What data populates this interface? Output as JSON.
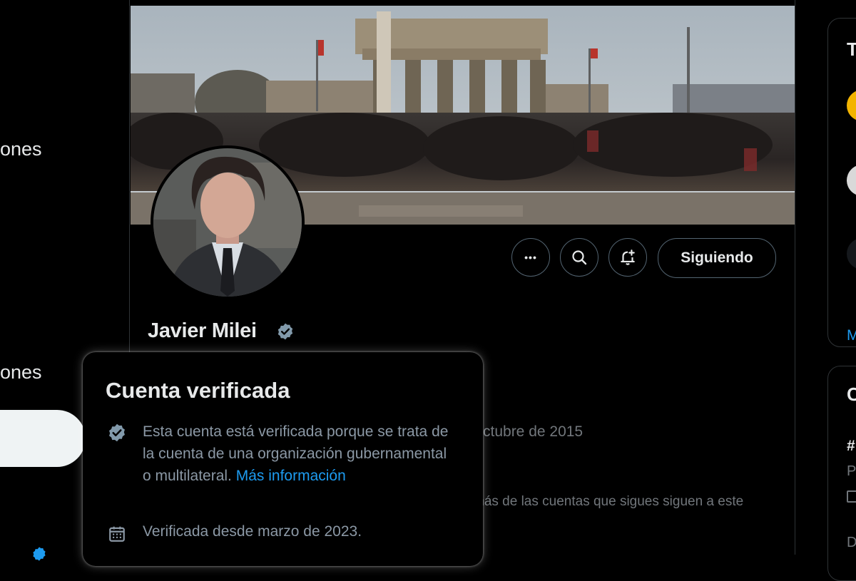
{
  "nav": {
    "item_a_partial": "ones",
    "item_b_partial": "ones"
  },
  "profile": {
    "name": "Javier Milei",
    "follow_label": "Siguiendo",
    "joined_partial": "ctubre de 2015",
    "followers_note_partial": "más de las cuentas que sigues siguen a este",
    "more_icon_glyph": "•••"
  },
  "verified_tooltip": {
    "title": "Cuenta verificada",
    "description": "Esta cuenta está verificada porque se trata de la cuenta de una organización gubernamental o multilateral.",
    "link_text": "Más información",
    "verified_since": "Verificada desde marzo de 2023."
  },
  "right_sidebar": {
    "card1_letter": "T",
    "card1_link_partial": "M",
    "card2_letter": "C",
    "card2_hash_partial": "#",
    "card2_muted_partial": "P",
    "card2_bottom_partial": "D"
  },
  "colors": {
    "background": "#000000",
    "text_primary": "#e7e9ea",
    "text_secondary": "#71767b",
    "accent": "#1d9bf0",
    "verified_badge": "#829aab",
    "border": "#2f3336"
  }
}
